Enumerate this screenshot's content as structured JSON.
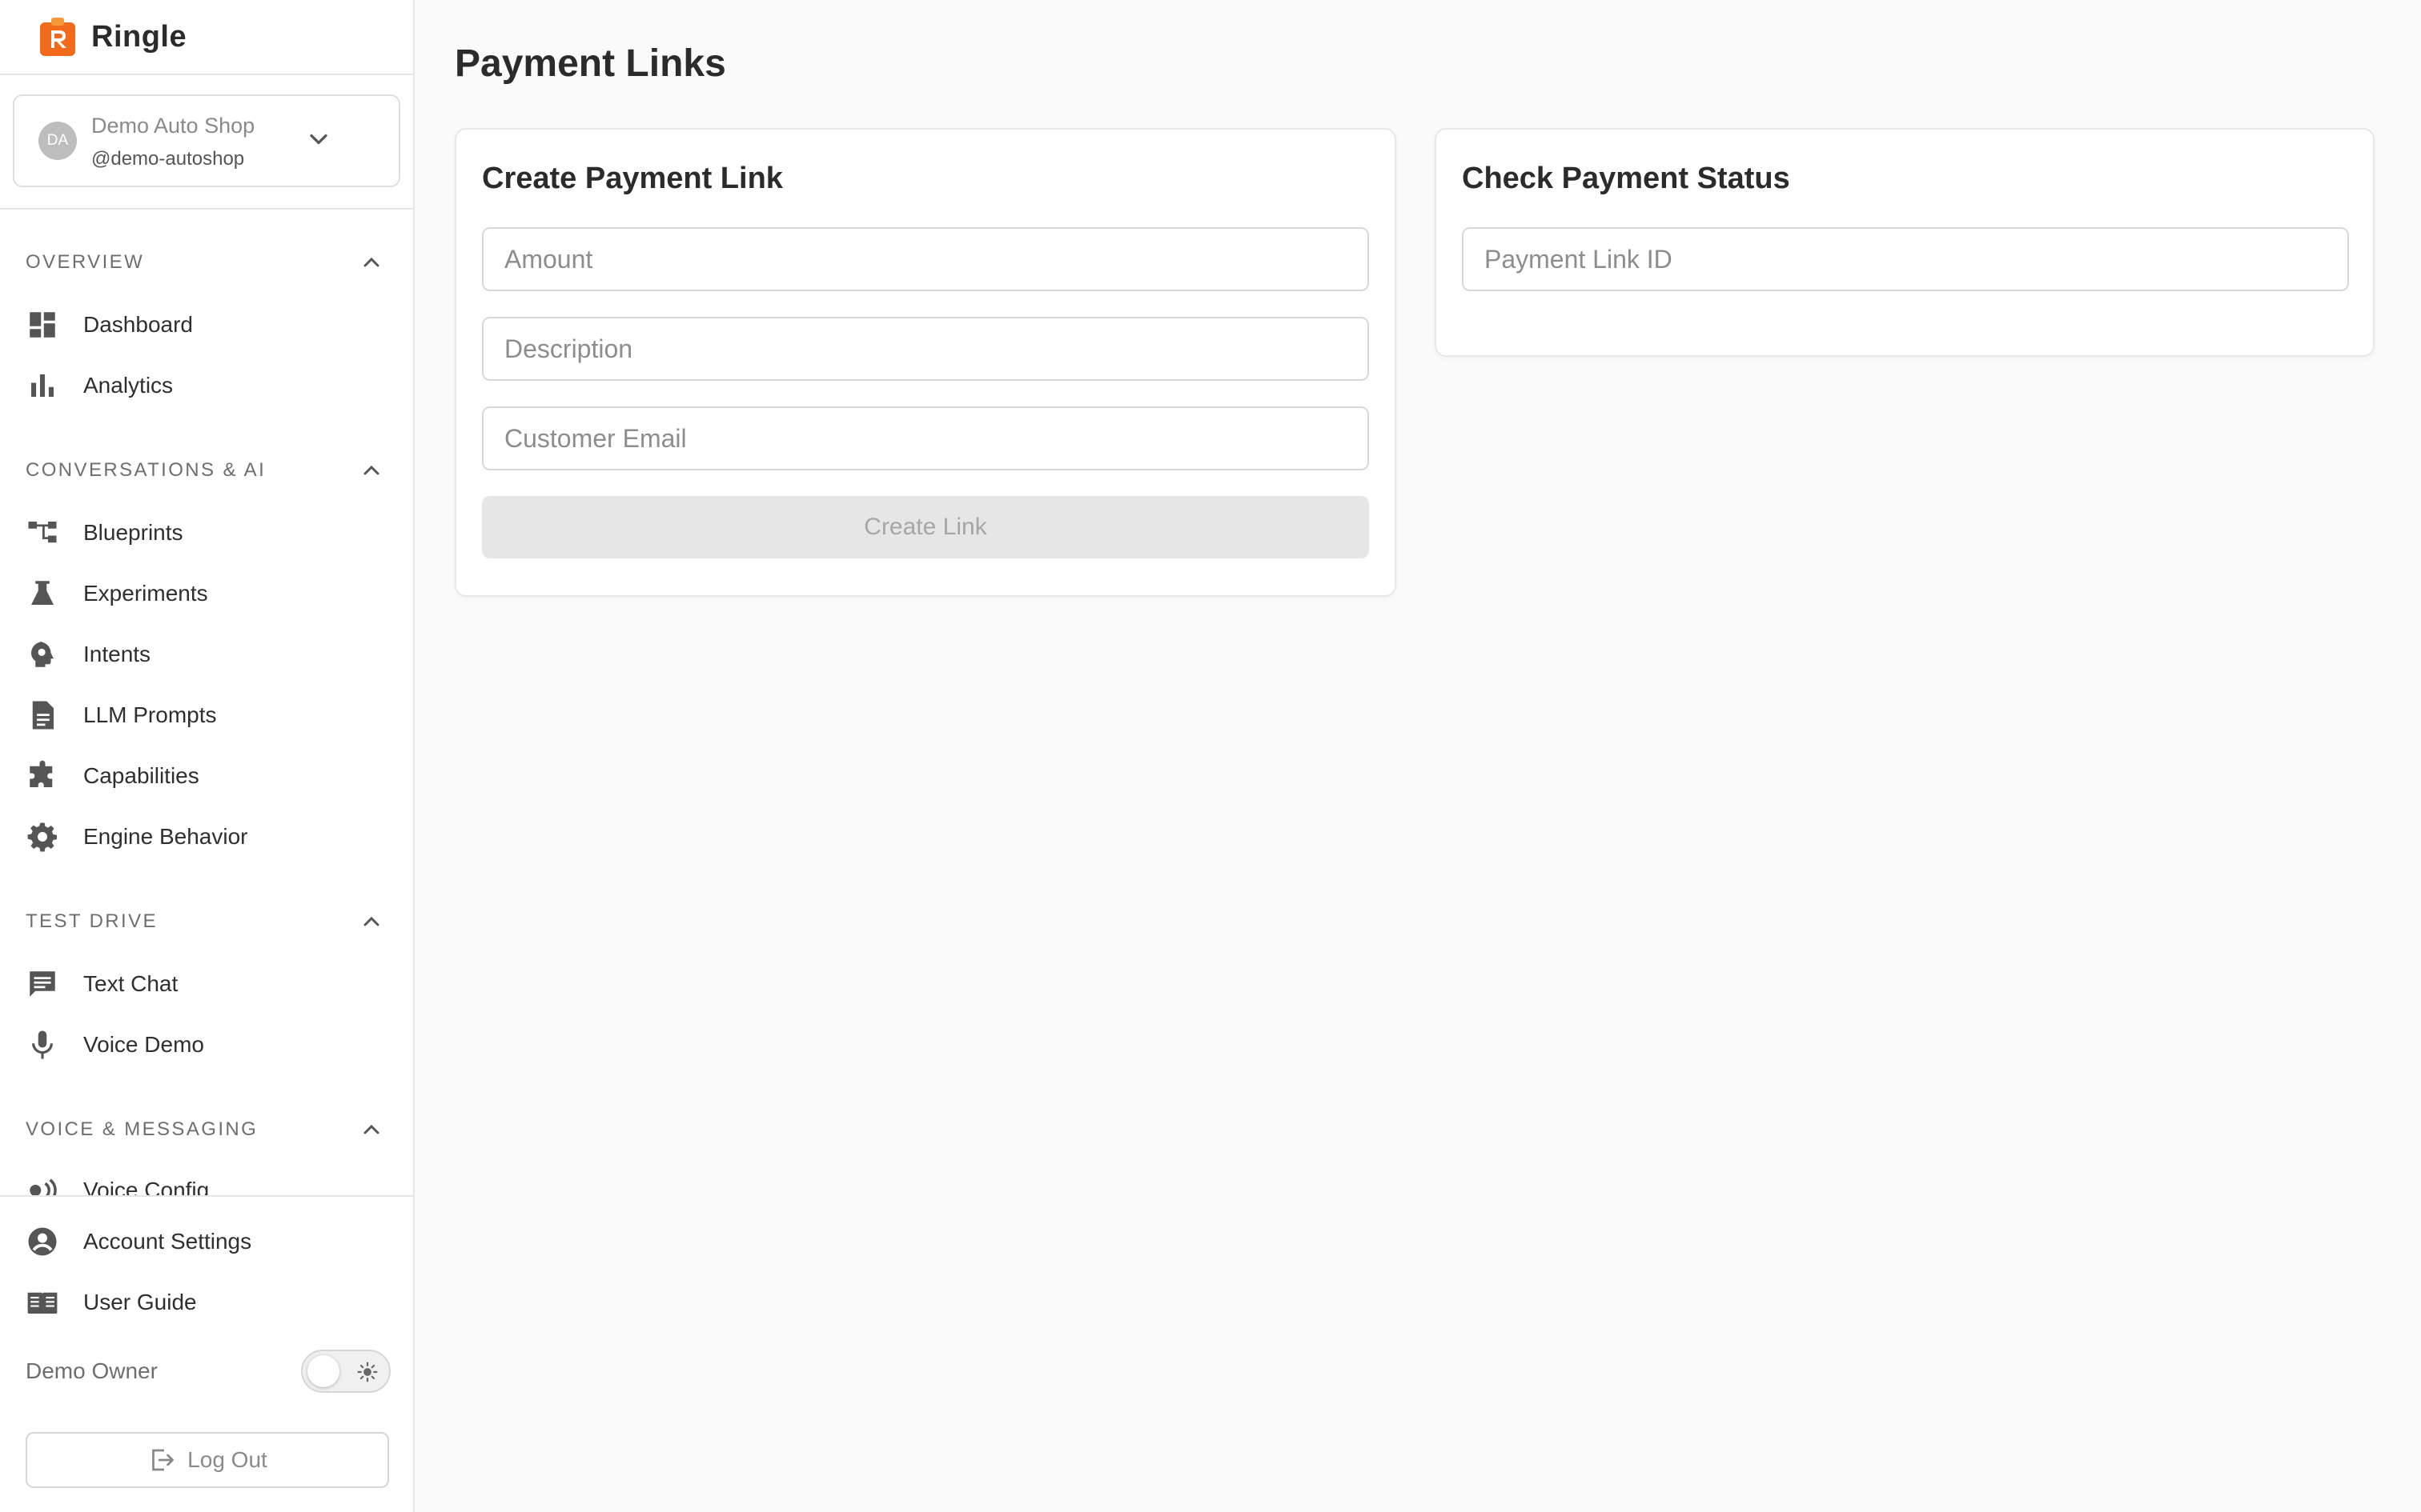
{
  "brand": {
    "name": "Ringle",
    "logo_icon": "ringle-logo-icon",
    "logo_letter": "R",
    "logo_color": "#f26b1d"
  },
  "account": {
    "avatar_initials": "DA",
    "name": "Demo Auto Shop",
    "handle": "@demo-autoshop"
  },
  "sections": [
    {
      "label": "OVERVIEW",
      "items": [
        {
          "label": "Dashboard",
          "icon": "dashboard-icon"
        },
        {
          "label": "Analytics",
          "icon": "bar-chart-icon"
        }
      ]
    },
    {
      "label": "CONVERSATIONS & AI",
      "items": [
        {
          "label": "Blueprints",
          "icon": "blueprint-tree-icon"
        },
        {
          "label": "Experiments",
          "icon": "flask-icon"
        },
        {
          "label": "Intents",
          "icon": "head-gear-icon"
        },
        {
          "label": "LLM Prompts",
          "icon": "document-icon"
        },
        {
          "label": "Capabilities",
          "icon": "puzzle-icon"
        },
        {
          "label": "Engine Behavior",
          "icon": "gear-icon"
        }
      ]
    },
    {
      "label": "TEST DRIVE",
      "items": [
        {
          "label": "Text Chat",
          "icon": "chat-icon"
        },
        {
          "label": "Voice Demo",
          "icon": "microphone-icon"
        }
      ]
    },
    {
      "label": "VOICE & MESSAGING",
      "items": [
        {
          "label": "Voice Config",
          "icon": "voice-waves-icon"
        }
      ]
    }
  ],
  "bottom_nav": [
    {
      "label": "Account Settings",
      "icon": "account-circle-icon"
    },
    {
      "label": "User Guide",
      "icon": "book-icon"
    }
  ],
  "owner": {
    "name": "Demo Owner",
    "theme_toggle_icon": "sun-icon"
  },
  "logout": {
    "label": "Log Out",
    "icon": "logout-icon"
  },
  "page": {
    "title": "Payment Links"
  },
  "create_card": {
    "title": "Create Payment Link",
    "amount_placeholder": "Amount",
    "description_placeholder": "Description",
    "email_placeholder": "Customer Email",
    "button_label": "Create Link"
  },
  "status_card": {
    "title": "Check Payment Status",
    "link_id_placeholder": "Payment Link ID"
  },
  "colors": {
    "accent": "#f26b1d",
    "background": "#fafafa",
    "icon": "#555555"
  }
}
